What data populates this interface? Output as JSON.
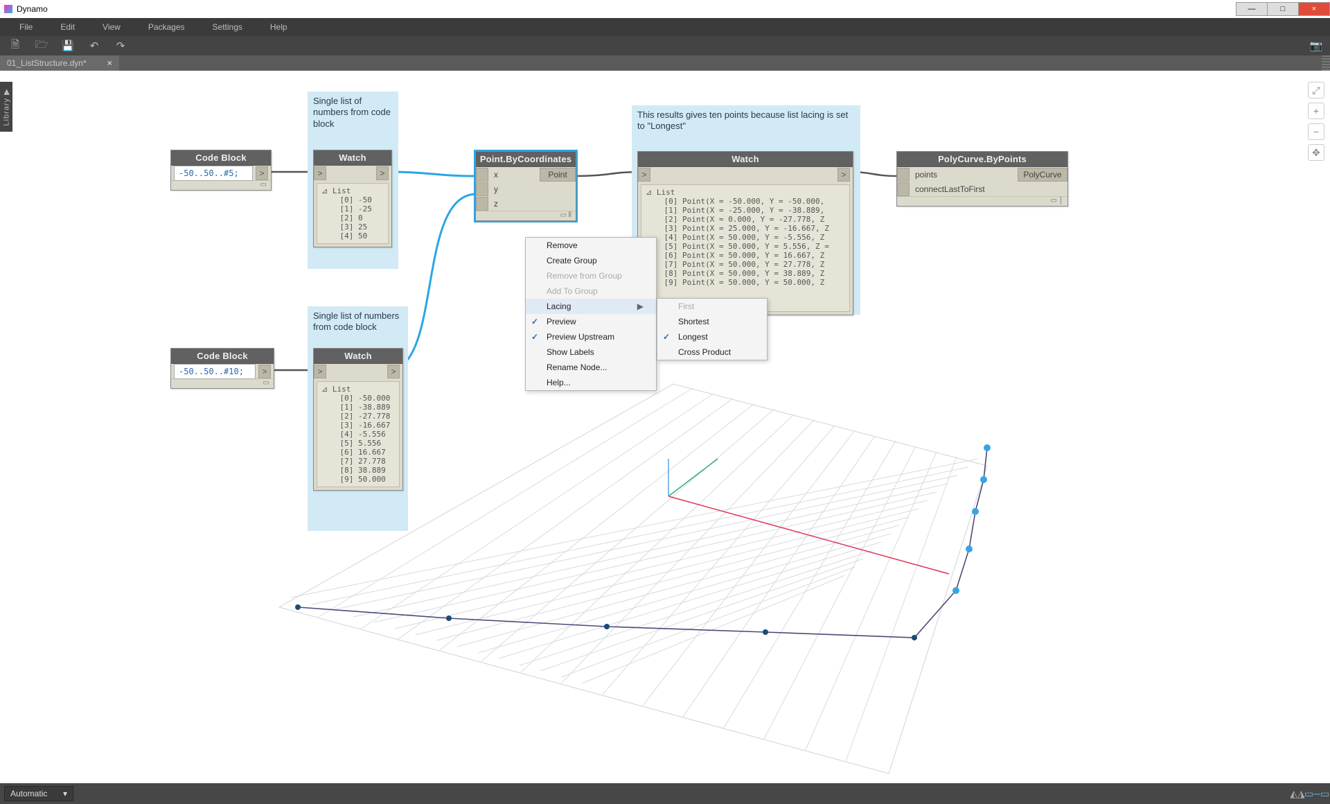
{
  "app": {
    "title": "Dynamo"
  },
  "window_controls": {
    "min": "—",
    "max": "□",
    "close": "×"
  },
  "menubar": [
    "File",
    "Edit",
    "View",
    "Packages",
    "Settings",
    "Help"
  ],
  "toolbar": {
    "icons": [
      "new-file-icon",
      "open-file-icon",
      "save-icon",
      "undo-icon",
      "redo-icon"
    ],
    "right_icon": "camera-icon"
  },
  "tab": {
    "name": "01_ListStructure.dyn*",
    "close": "×"
  },
  "library_tab": "Library ▶",
  "viewport_controls": {
    "fit": "⤢",
    "zoom_in": "+",
    "zoom_out": "−",
    "home": "✥"
  },
  "groups": {
    "g1": {
      "title": "Single list of numbers from code block"
    },
    "g2": {
      "title": "Single list of numbers from code block"
    },
    "g3": {
      "title": "This results gives ten points because list lacing is set to \"Longest\""
    }
  },
  "nodes": {
    "codeblock1": {
      "title": "Code Block",
      "code": "-50..50..#5;",
      "out": ">"
    },
    "codeblock2": {
      "title": "Code Block",
      "code": "-50..50..#10;",
      "out": ">"
    },
    "watch1": {
      "title": "Watch",
      "in": ">",
      "out": ">",
      "body": "⊿ List\n    [0] -50\n    [1] -25\n    [2] 0\n    [3] 25\n    [4] 50"
    },
    "watch2": {
      "title": "Watch",
      "in": ">",
      "out": ">",
      "body": "⊿ List\n    [0] -50.000\n    [1] -38.889\n    [2] -27.778\n    [3] -16.667\n    [4] -5.556\n    [5] 5.556\n    [6] 16.667\n    [7] 27.778\n    [8] 38.889\n    [9] 50.000"
    },
    "point": {
      "title": "Point.ByCoordinates",
      "inputs": [
        "x",
        "y",
        "z"
      ],
      "output": "Point"
    },
    "watch3": {
      "title": "Watch",
      "in": ">",
      "out": ">",
      "body": "⊿ List\n    [0] Point(X = -50.000, Y = -50.000,\n    [1] Point(X = -25.000, Y = -38.889,\n    [2] Point(X = 0.000, Y = -27.778, Z\n    [3] Point(X = 25.000, Y = -16.667, Z\n    [4] Point(X = 50.000, Y = -5.556, Z\n    [5] Point(X = 50.000, Y = 5.556, Z =\n    [6] Point(X = 50.000, Y = 16.667, Z\n    [7] Point(X = 50.000, Y = 27.778, Z\n    [8] Point(X = 50.000, Y = 38.889, Z\n    [9] Point(X = 50.000, Y = 50.000, Z"
    },
    "polycurve": {
      "title": "PolyCurve.ByPoints",
      "inputs": [
        "points",
        "connectLastToFirst"
      ],
      "output": "PolyCurve"
    }
  },
  "context_menu": {
    "items": [
      {
        "label": "Remove"
      },
      {
        "label": "Create Group"
      },
      {
        "label": "Remove from Group",
        "disabled": true
      },
      {
        "label": "Add To Group",
        "disabled": true
      },
      {
        "label": "Lacing",
        "submenu": true,
        "highlight": true
      },
      {
        "label": "Preview",
        "checked": true
      },
      {
        "label": "Preview Upstream",
        "checked": true
      },
      {
        "label": "Show Labels"
      },
      {
        "label": "Rename Node..."
      },
      {
        "label": "Help..."
      }
    ]
  },
  "lacing_submenu": {
    "items": [
      {
        "label": "First",
        "disabled": true
      },
      {
        "label": "Shortest"
      },
      {
        "label": "Longest",
        "checked": true
      },
      {
        "label": "Cross Product"
      }
    ]
  },
  "statusbar": {
    "mode": "Automatic",
    "arrow": "▾"
  }
}
